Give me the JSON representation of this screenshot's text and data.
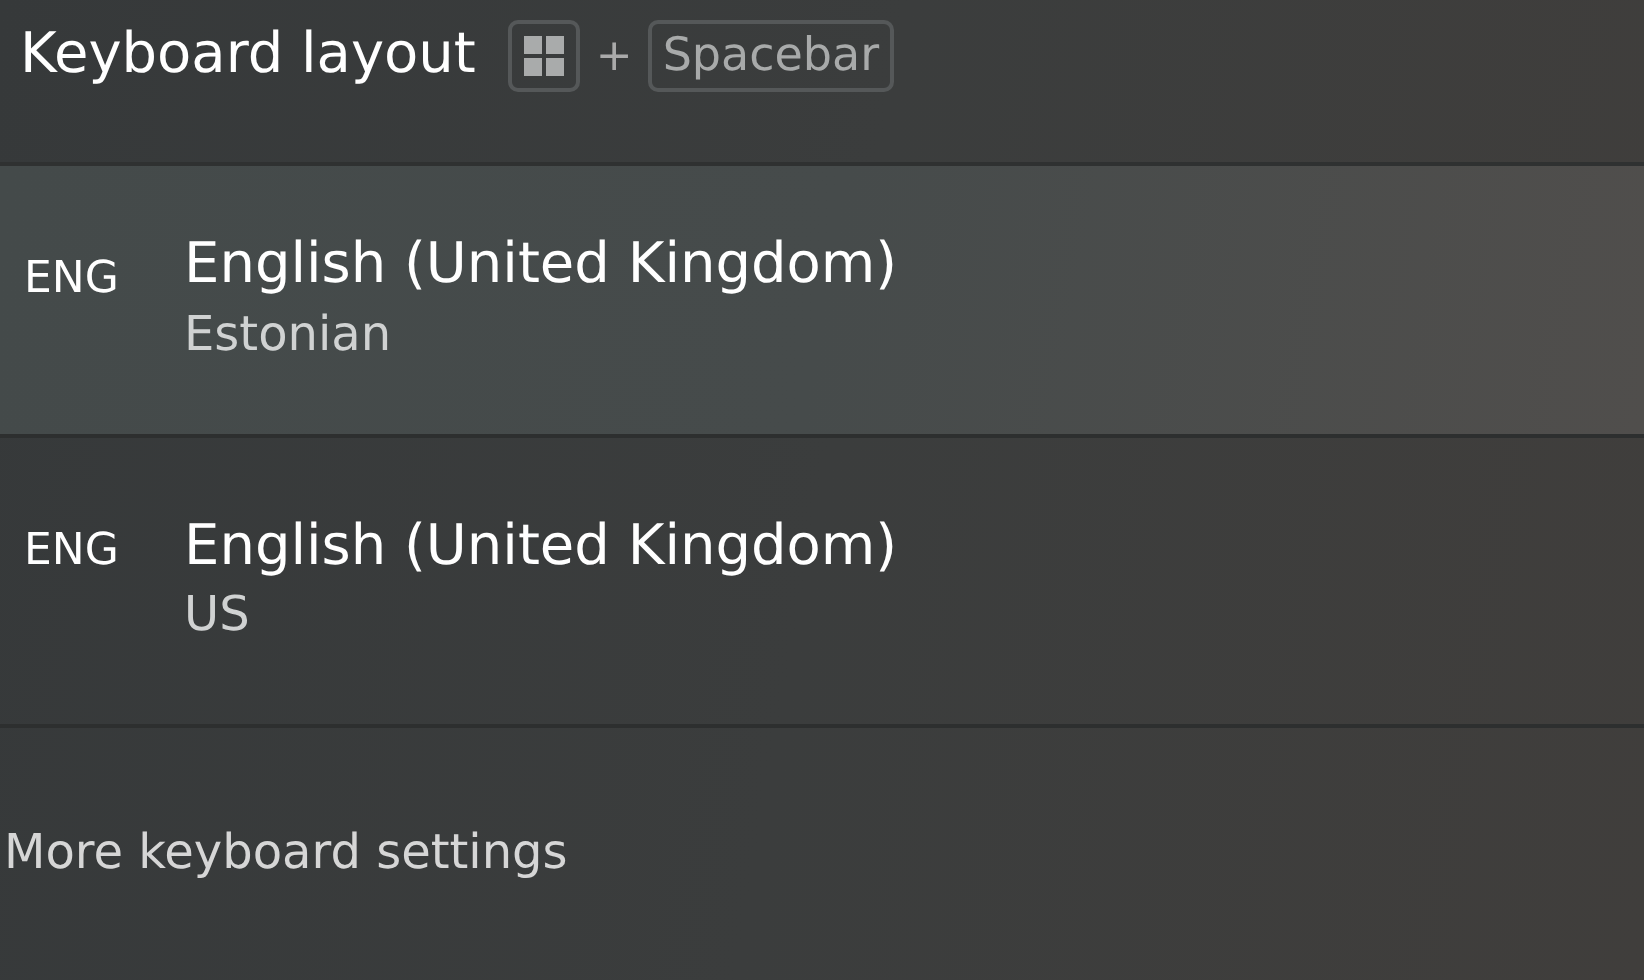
{
  "header": {
    "title": "Keyboard layout",
    "shortcut_plus": "+",
    "shortcut_key": "Spacebar"
  },
  "layouts": [
    {
      "code": "ENG",
      "language": "English (United Kingdom)",
      "keyboard": "Estonian",
      "selected": true
    },
    {
      "code": "ENG",
      "language": "English (United Kingdom)",
      "keyboard": "US",
      "selected": false
    }
  ],
  "footer": {
    "link": "More keyboard settings"
  }
}
